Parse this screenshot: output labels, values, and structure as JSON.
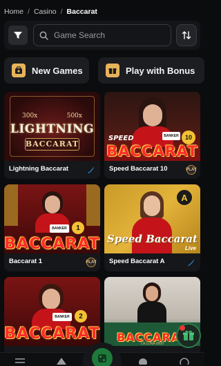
{
  "breadcrumb": {
    "items": [
      "Home",
      "Casino",
      "Baccarat"
    ],
    "separator": "/"
  },
  "search": {
    "placeholder": "Game Search"
  },
  "categories": [
    {
      "label": "New Games",
      "icon": "new-games-icon"
    },
    {
      "label": "Play with Bonus",
      "icon": "gift-icon"
    }
  ],
  "games": [
    {
      "name": "Lightning Baccarat",
      "provider_icon": "evolution-icon",
      "thumb_texts": [
        "300x",
        "500x",
        "LIGHTNING",
        "BACCARAT"
      ]
    },
    {
      "name": "Speed Baccarat 10",
      "provider_icon": "pragmatic-icon",
      "thumb_texts": [
        "SPEED",
        "BANKER",
        "10",
        "BACCARAT"
      ]
    },
    {
      "name": "Baccarat 1",
      "provider_icon": "pragmatic-icon",
      "thumb_texts": [
        "BANKER",
        "1",
        "BACCARAT"
      ]
    },
    {
      "name": "Speed Baccarat A",
      "provider_icon": "evolution-icon",
      "thumb_texts": [
        "A",
        "Speed Baccarat",
        "Live"
      ]
    },
    {
      "name": "",
      "provider_icon": "",
      "thumb_texts": [
        "BANKER",
        "2",
        "BACCARAT"
      ]
    },
    {
      "name": "",
      "provider_icon": "",
      "thumb_texts": [
        "BACCARAT",
        "LA LUNA 0000"
      ]
    }
  ],
  "provider_badges": {
    "pragmatic": "PLAY"
  },
  "colors": {
    "background": "#0b0c0e",
    "card": "#16171a",
    "accent_gold": "#e7b35a",
    "accent_green": "#1e7a3a",
    "accent_blue": "#2f8fe0"
  }
}
